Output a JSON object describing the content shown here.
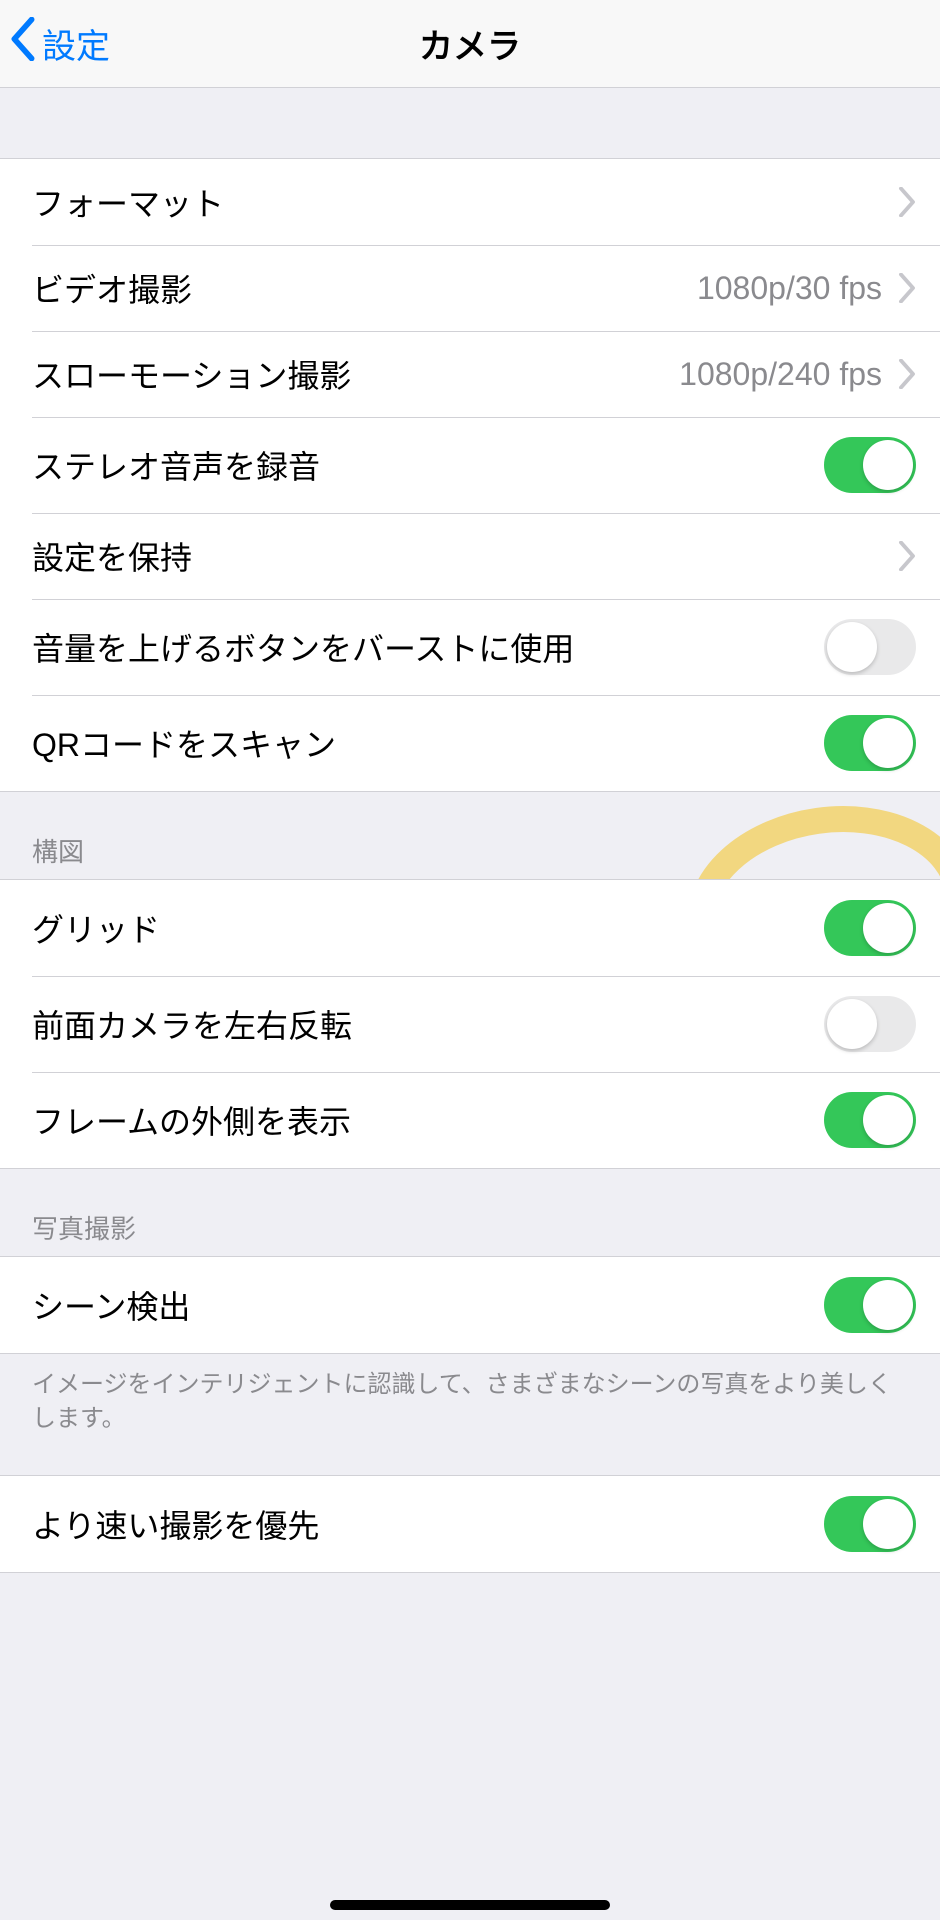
{
  "nav": {
    "back_label": "設定",
    "title": "カメラ"
  },
  "groups": [
    {
      "id": "main",
      "header": "",
      "footer": "",
      "rows": [
        {
          "id": "format",
          "label": "フォーマット",
          "value": "",
          "type": "disclosure",
          "on": null
        },
        {
          "id": "record-video",
          "label": "ビデオ撮影",
          "value": "1080p/30 fps",
          "type": "disclosure",
          "on": null
        },
        {
          "id": "record-slomo",
          "label": "スローモーション撮影",
          "value": "1080p/240 fps",
          "type": "disclosure",
          "on": null
        },
        {
          "id": "stereo-audio",
          "label": "ステレオ音声を録音",
          "value": "",
          "type": "toggle",
          "on": true
        },
        {
          "id": "preserve",
          "label": "設定を保持",
          "value": "",
          "type": "disclosure",
          "on": null
        },
        {
          "id": "volume-burst",
          "label": "音量を上げるボタンをバーストに使用",
          "value": "",
          "type": "toggle",
          "on": false
        },
        {
          "id": "scan-qr",
          "label": "QRコードをスキャン",
          "value": "",
          "type": "toggle",
          "on": true
        }
      ]
    },
    {
      "id": "composition",
      "header": "構図",
      "footer": "",
      "rows": [
        {
          "id": "grid",
          "label": "グリッド",
          "value": "",
          "type": "toggle",
          "on": true
        },
        {
          "id": "mirror-front",
          "label": "前面カメラを左右反転",
          "value": "",
          "type": "toggle",
          "on": false
        },
        {
          "id": "view-outside",
          "label": "フレームの外側を表示",
          "value": "",
          "type": "toggle",
          "on": true
        }
      ]
    },
    {
      "id": "photo-capture",
      "header": "写真撮影",
      "footer": "イメージをインテリジェントに認識して、さまざまなシーンの写真をより美しくします。",
      "rows": [
        {
          "id": "scene-detect",
          "label": "シーン検出",
          "value": "",
          "type": "toggle",
          "on": true
        }
      ]
    },
    {
      "id": "faster",
      "header": "",
      "footer": "",
      "rows": [
        {
          "id": "prioritize-fast",
          "label": "より速い撮影を優先",
          "value": "",
          "type": "toggle",
          "on": true
        }
      ]
    }
  ],
  "annotation": {
    "present": true,
    "target_row": "grid",
    "color": "#f2d26b"
  }
}
